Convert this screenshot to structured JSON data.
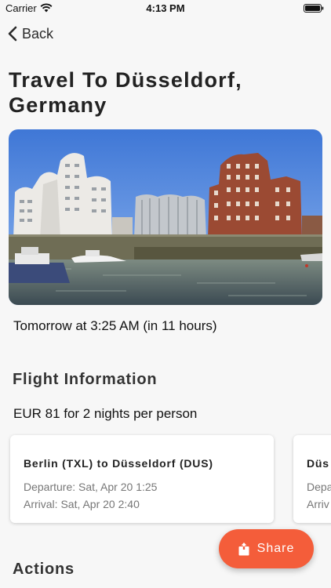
{
  "status_bar": {
    "carrier": "Carrier",
    "time": "4:13 PM"
  },
  "nav": {
    "back_label": "Back"
  },
  "trip": {
    "title": "Travel To Düsseldorf, Germany",
    "departure_time": "Tomorrow at 3:25 AM (in 11 hours)"
  },
  "flight_info": {
    "section_title": "Flight Information",
    "price": "EUR 81 for 2 nights per person",
    "cards": [
      {
        "route": "Berlin (TXL) to Düsseldorf (DUS)",
        "departure": "Departure: Sat, Apr 20 1:25",
        "arrival": "Arrival: Sat, Apr 20 2:40"
      },
      {
        "route": "Düs",
        "departure": "Depa",
        "arrival": "Arriv"
      }
    ]
  },
  "actions": {
    "section_title": "Actions",
    "share_label": "Share"
  },
  "colors": {
    "accent": "#f45d3a",
    "background": "#f7f7f7"
  },
  "icons": {
    "wifi": "wifi-icon",
    "battery": "battery-icon",
    "back": "chevron-left-icon",
    "share": "share-icon"
  }
}
